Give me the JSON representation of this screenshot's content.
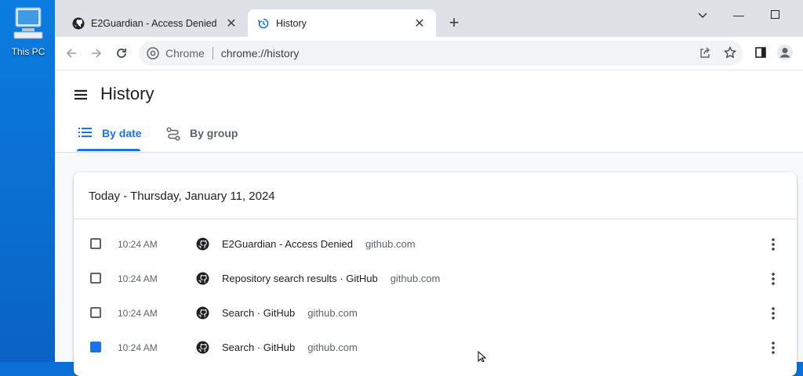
{
  "desktop": {
    "icon_label": "This PC",
    "icon_name": "computer-icon"
  },
  "tabs": [
    {
      "title": "E2Guardian - Access Denied",
      "icon": "github-icon",
      "active": false
    },
    {
      "title": "History",
      "icon": "history-icon",
      "active": true
    }
  ],
  "omnibox": {
    "chrome_label": "Chrome",
    "url": "chrome://history"
  },
  "history": {
    "title": "History",
    "tab_by_date": "By date",
    "tab_by_group": "By group",
    "day_header": "Today - Thursday, January 11, 2024",
    "entries": [
      {
        "time": "10:24 AM",
        "title": "E2Guardian - Access Denied",
        "domain": "github.com",
        "checked": false
      },
      {
        "time": "10:24 AM",
        "title": "Repository search results · GitHub",
        "domain": "github.com",
        "checked": false
      },
      {
        "time": "10:24 AM",
        "title": "Search · GitHub",
        "domain": "github.com",
        "checked": false
      },
      {
        "time": "10:24 AM",
        "title": "Search · GitHub",
        "domain": "github.com",
        "checked": true
      }
    ]
  },
  "colors": {
    "accent": "#1a73e8",
    "desktop": "#0a6fd6",
    "tabstrip": "#dee1e6"
  }
}
